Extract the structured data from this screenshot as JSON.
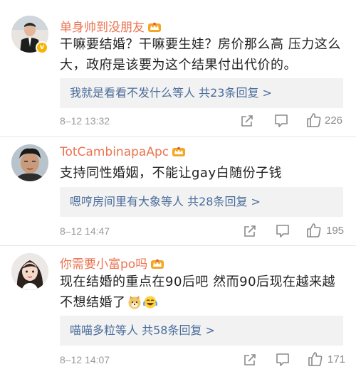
{
  "comments": [
    {
      "username": "单身帅到没朋友",
      "content": "干嘛要结婚？干嘛要生娃？房价那么高 压力这么大，政府是该要为这个结果付出代价的。",
      "reply_text": "我就是看看不发什么等人 共23条回复 >",
      "timestamp": "8–12 13:32",
      "likes": "226",
      "verified_badge": "v"
    },
    {
      "username": "TotCambinapaApc",
      "content": "支持同性婚姻，不能让gay白随份子钱",
      "reply_text": "嗯哼房间里有大象等人 共28条回复 >",
      "timestamp": "8–12 14:47",
      "likes": "195"
    },
    {
      "username": "你需要小富po吗",
      "content": "现在结婚的重点在90后吧 然而90后现在越来越不想结婚了",
      "reply_text": "喵喵多粒等人 共58条回复 >",
      "timestamp": "8–12 14:07",
      "likes": "171"
    }
  ],
  "icons": {
    "crown": "crown-badge-icon",
    "share": "share-icon",
    "comment": "comment-icon",
    "like": "thumbs-up-icon",
    "doge": "doge-emoji",
    "laugh_cry": "laugh-cry-emoji"
  },
  "colors": {
    "username": "#eb7350",
    "reply_link": "#4a6c9b",
    "reply_bg": "#f2f2f2",
    "meta": "#9a9a9a",
    "verified": "#f7b500"
  }
}
